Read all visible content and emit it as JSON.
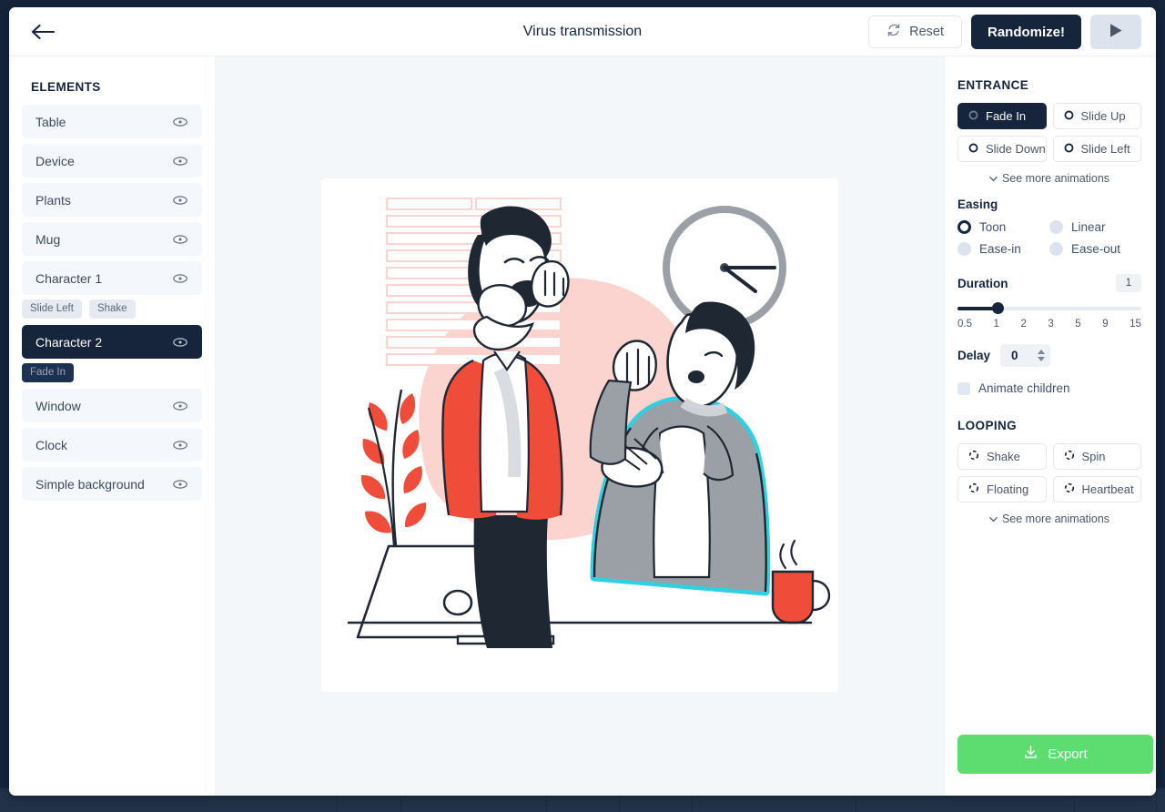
{
  "header": {
    "title": "Virus transmission",
    "back_icon": "arrow-left-icon",
    "reset_label": "Reset",
    "reset_icon": "refresh-icon",
    "randomize_label": "Randomize!",
    "play_icon": "play-icon"
  },
  "sidebar": {
    "heading": "ELEMENTS",
    "items": [
      {
        "label": "Table",
        "selected": false,
        "tags": []
      },
      {
        "label": "Device",
        "selected": false,
        "tags": []
      },
      {
        "label": "Plants",
        "selected": false,
        "tags": []
      },
      {
        "label": "Mug",
        "selected": false,
        "tags": []
      },
      {
        "label": "Character 1",
        "selected": false,
        "tags": [
          "Slide Left",
          "Shake"
        ]
      },
      {
        "label": "Character 2",
        "selected": true,
        "tags": [
          "Fade In"
        ]
      },
      {
        "label": "Window",
        "selected": false,
        "tags": []
      },
      {
        "label": "Clock",
        "selected": false,
        "tags": []
      },
      {
        "label": "Simple background",
        "selected": false,
        "tags": []
      }
    ],
    "visibility_icon": "eye-icon"
  },
  "panel": {
    "entrance": {
      "heading": "ENTRANCE",
      "options": [
        {
          "label": "Fade In",
          "active": true
        },
        {
          "label": "Slide Up",
          "active": false
        },
        {
          "label": "Slide Down",
          "active": false
        },
        {
          "label": "Slide Left",
          "active": false
        }
      ],
      "see_more": "See more animations"
    },
    "easing": {
      "label": "Easing",
      "options": [
        {
          "label": "Toon",
          "selected": true
        },
        {
          "label": "Linear",
          "selected": false
        },
        {
          "label": "Ease-in",
          "selected": false
        },
        {
          "label": "Ease-out",
          "selected": false
        }
      ]
    },
    "duration": {
      "label": "Duration",
      "value": "1",
      "ticks": [
        "0.5",
        "1",
        "2",
        "3",
        "5",
        "9",
        "15"
      ],
      "fill_percent": 22
    },
    "delay": {
      "label": "Delay",
      "value": "0"
    },
    "animate_children": {
      "label": "Animate children",
      "checked": false
    },
    "looping": {
      "heading": "LOOPING",
      "options": [
        {
          "label": "Shake"
        },
        {
          "label": "Spin"
        },
        {
          "label": "Floating"
        },
        {
          "label": "Heartbeat"
        }
      ],
      "see_more": "See more animations"
    },
    "export": {
      "label": "Export",
      "icon": "download-icon",
      "color": "#5ddc70"
    }
  },
  "canvas": {
    "illustration_name": "virus-transmission-illustration",
    "colors": {
      "blob": "#fbd4cf",
      "red": "#ef4c3a",
      "gray": "#9aa0a6",
      "dark": "#16243c",
      "highlight": "#2fd0e0"
    }
  }
}
